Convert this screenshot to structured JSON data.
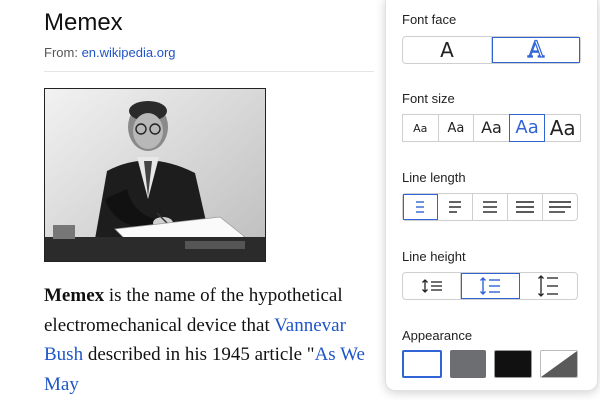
{
  "article": {
    "title": "Memex",
    "from_label": "From: ",
    "from_link": "en.wikipedia.org",
    "photo_alt": "portrait-photo",
    "paragraph": {
      "bold": "Memex",
      "t1": " is the name of the hypothetical electromechanical device that ",
      "link1": "Vannevar Bush",
      "t2": " described in his 1945 article \"",
      "link2": "As We May"
    }
  },
  "panel": {
    "font_face_label": "Font face",
    "font_faces": [
      {
        "glyph": "A",
        "style": "sans",
        "selected": false
      },
      {
        "glyph": "A",
        "style": "outline",
        "selected": true
      }
    ],
    "font_size_label": "Font size",
    "font_sizes": [
      {
        "glyph": "Aa",
        "selected": false
      },
      {
        "glyph": "Aa",
        "selected": false
      },
      {
        "glyph": "Aa",
        "selected": false
      },
      {
        "glyph": "Aa",
        "selected": true
      },
      {
        "glyph": "Aa",
        "selected": false
      }
    ],
    "line_length_label": "Line length",
    "line_lengths_selected": 0,
    "line_height_label": "Line height",
    "line_heights_selected": 1,
    "appearance_label": "Appearance",
    "appearances": [
      {
        "name": "white",
        "color": "#ffffff",
        "selected": true
      },
      {
        "name": "gray",
        "color": "#6d6e71",
        "selected": false
      },
      {
        "name": "black",
        "color": "#111111",
        "selected": false
      },
      {
        "name": "auto",
        "color": "#5a5a5a",
        "selected": false
      }
    ],
    "accent": "#2f63d6"
  }
}
